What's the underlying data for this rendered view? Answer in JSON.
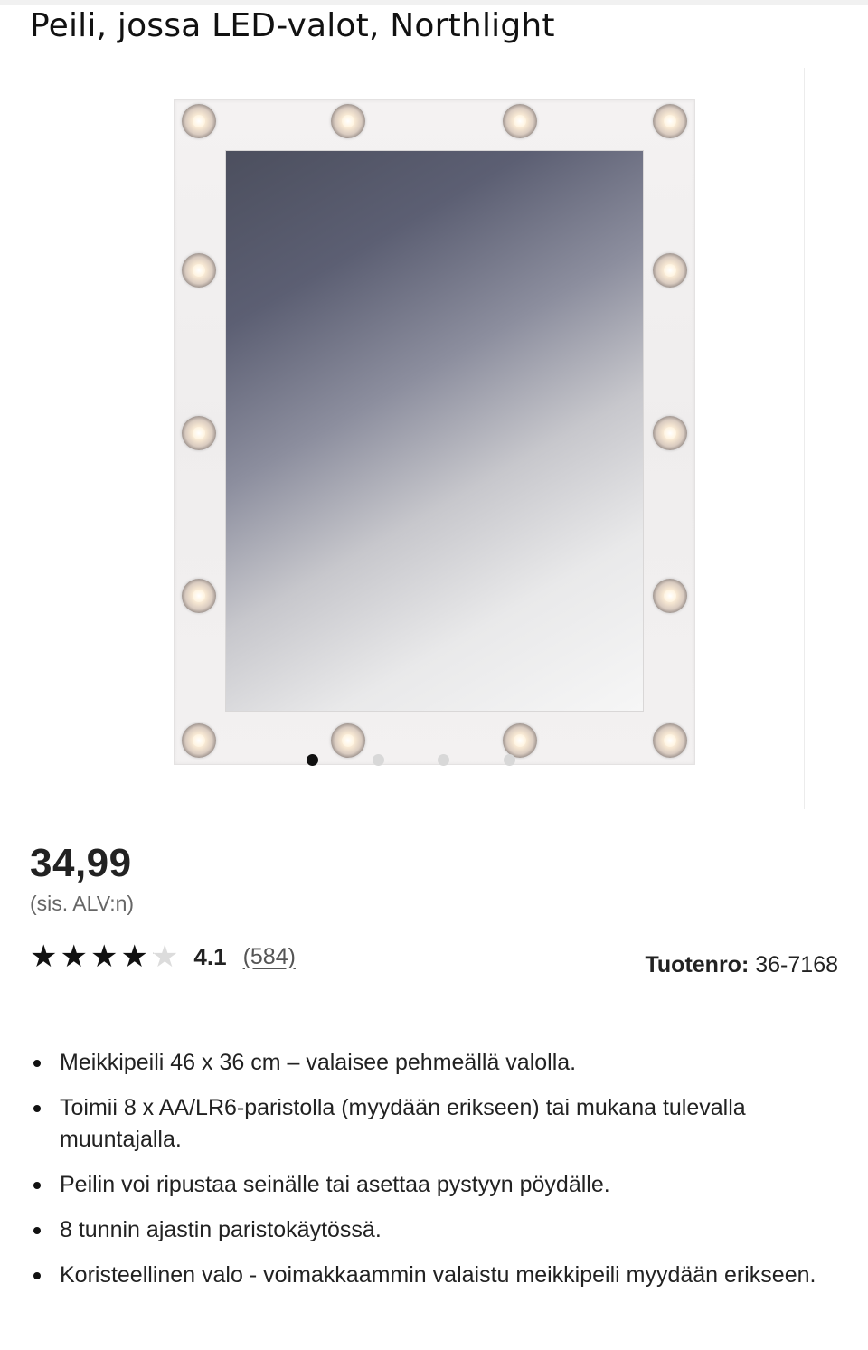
{
  "product": {
    "title": "Peili, jossa LED-valot, Northlight",
    "price": "34,99",
    "vat_note": "(sis. ALV:n)",
    "rating": {
      "stars_value": 4.1,
      "stars_max": 5,
      "value_text": "4.1",
      "review_count": "(584)"
    },
    "sku": {
      "label": "Tuotenro:",
      "value": "36-7168"
    }
  },
  "gallery": {
    "image_count": 4,
    "active_index": 0
  },
  "features": [
    "Meikkipeili 46 x 36 cm – valaisee pehmeällä valolla.",
    "Toimii 8 x AA/LR6-paristolla (myydään erikseen) tai mukana tulevalla muuntajalla.",
    "Peilin voi ripustaa seinälle tai asettaa pystyyn pöydälle.",
    "8 tunnin ajastin paristokäytössä.",
    "Koristeellinen valo - voimakkaammin valaistu meikkipeili myydään erikseen."
  ]
}
